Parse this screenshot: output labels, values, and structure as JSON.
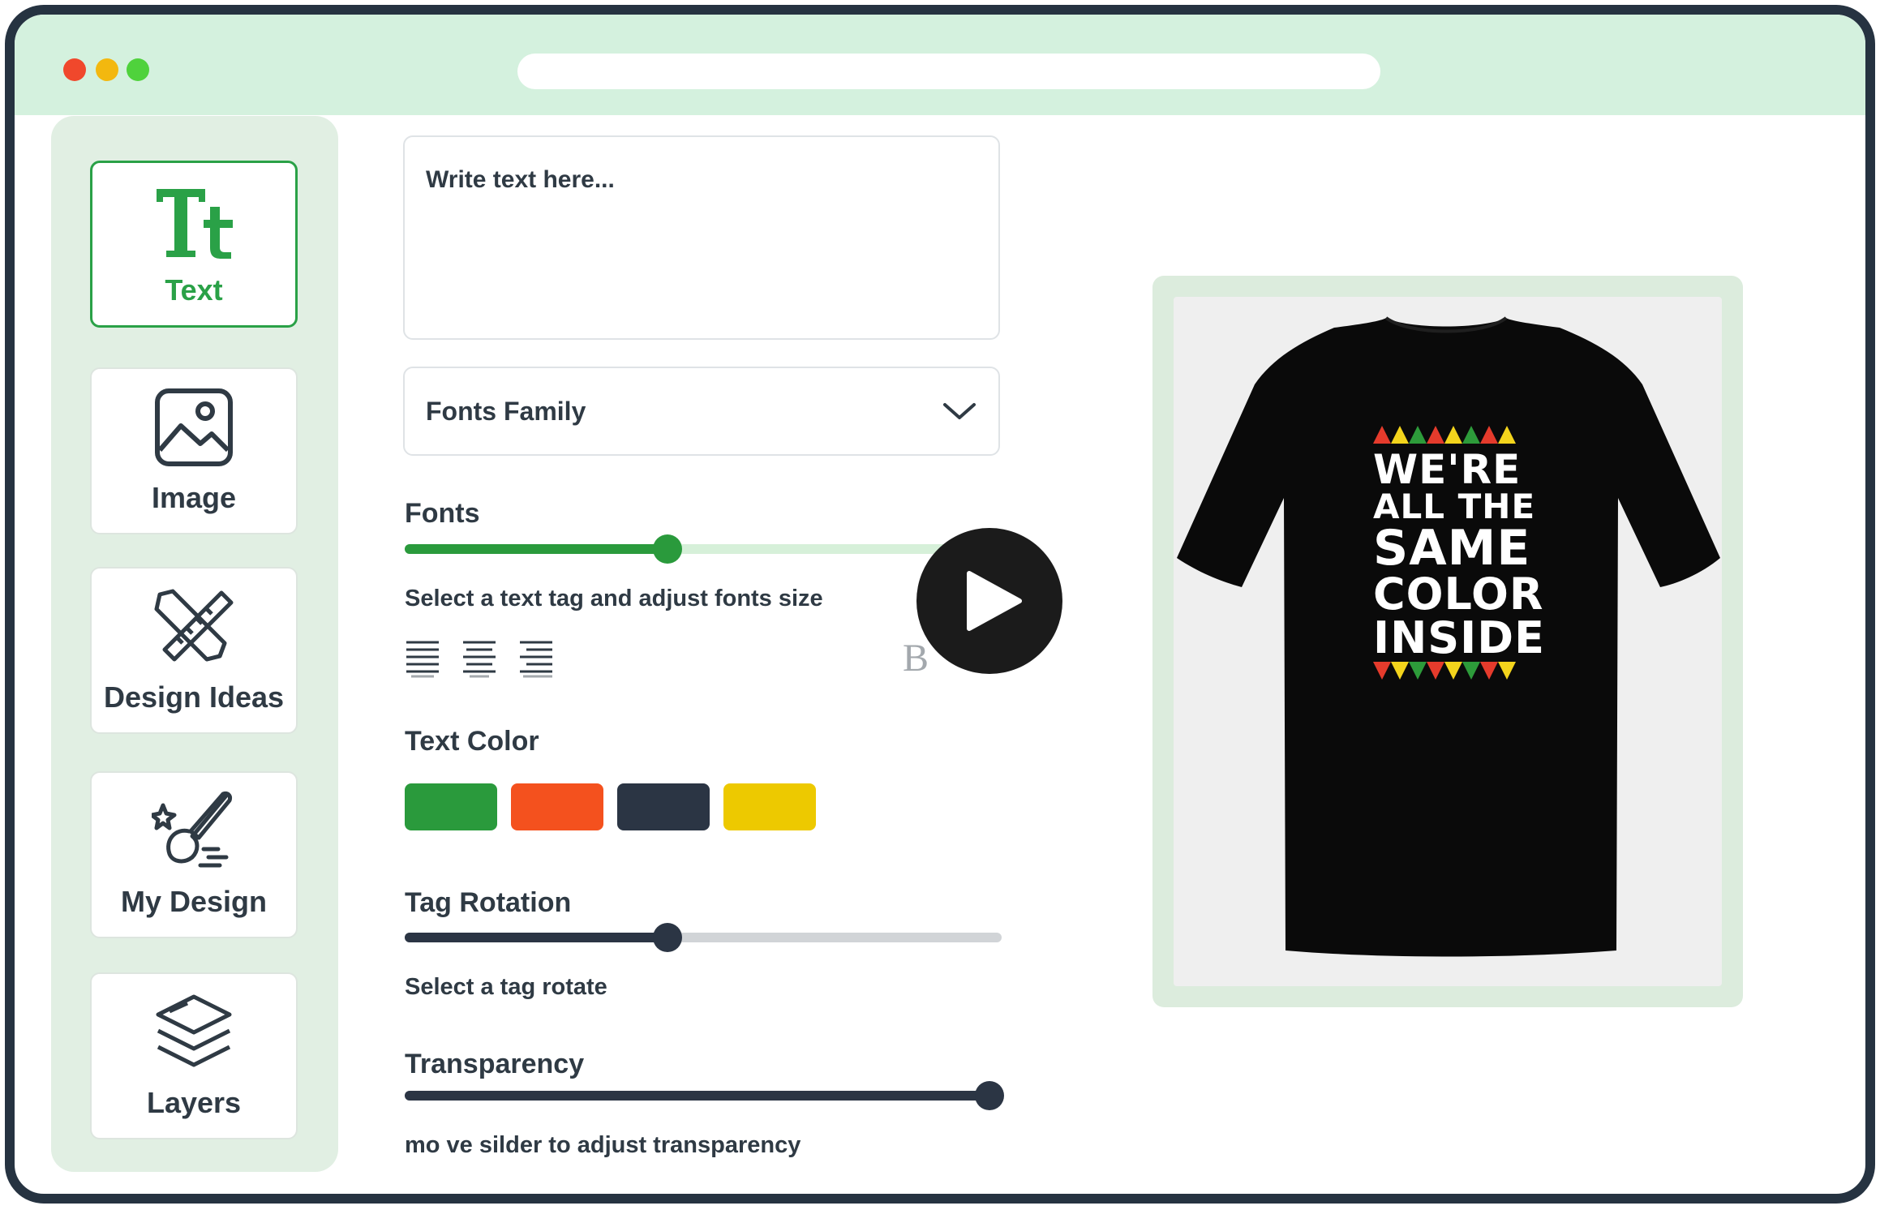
{
  "window": {
    "controls": [
      "close",
      "minimize",
      "maximize"
    ]
  },
  "sidebar": {
    "items": [
      {
        "label": "Text",
        "icon": "text-tt-icon",
        "active": true
      },
      {
        "label": "Image",
        "icon": "image-icon",
        "active": false
      },
      {
        "label": "Design Ideas",
        "icon": "pencil-ruler-icon",
        "active": false
      },
      {
        "label": "My Design",
        "icon": "brush-icon",
        "active": false
      },
      {
        "label": "Layers",
        "icon": "layers-icon",
        "active": false
      }
    ]
  },
  "editor": {
    "text_placeholder": "Write text here...",
    "font_family": {
      "selected": "Fonts Family",
      "icon": "chevron-down-icon"
    },
    "fonts": {
      "heading": "Fonts",
      "hint": "Select a text tag and adjust fonts size",
      "level": 0.44
    },
    "alignment_icons": [
      "align-left-icon",
      "align-center-icon",
      "align-justify-icon",
      "bold-icon"
    ],
    "text_color": {
      "heading": "Text Color",
      "swatches": [
        "#2a9a3c",
        "#f4511e",
        "#2b3544",
        "#edc900"
      ]
    },
    "tag_rotation": {
      "heading": "Tag Rotation",
      "hint": "Select a tag rotate",
      "level": 0.44
    },
    "transparency": {
      "heading": "Transparency",
      "hint": "mo ve silder to adjust transparency",
      "level": 0.98
    }
  },
  "play_button": {
    "icon": "play-icon"
  },
  "preview": {
    "product": "t-shirt",
    "shirt_color": "#0a0a0a",
    "print_lines": [
      "WE'RE",
      "ALL THE",
      "SAME",
      "COLOR",
      "INSIDE"
    ],
    "triangle_colors": [
      "#e53b2c",
      "#f3d41c",
      "#2d9b3a"
    ]
  },
  "colors": {
    "accent": "#2aa147",
    "titlebar": "#d4f1de",
    "frame": "#263341"
  }
}
